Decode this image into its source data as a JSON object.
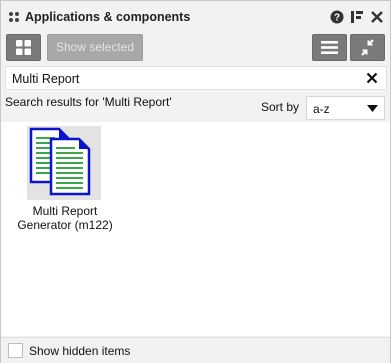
{
  "window": {
    "title": "Applications & components"
  },
  "toolbar": {
    "show_selected_label": "Show selected"
  },
  "search": {
    "value": "Multi Report",
    "results_text": "Search results for 'Multi Report'"
  },
  "sort": {
    "label": "Sort by",
    "value": "a-z"
  },
  "results": [
    {
      "name_line1": "Multi Report",
      "name_line2": "Generator (m122)"
    }
  ],
  "footer": {
    "show_hidden_label": "Show hidden items",
    "show_hidden_checked": false
  },
  "colors": {
    "accent_blue": "#0b14c8",
    "doc_lines": "#3aa84a",
    "dark_button": "#7a7a7a",
    "disabled_button": "#a8a8a8"
  }
}
